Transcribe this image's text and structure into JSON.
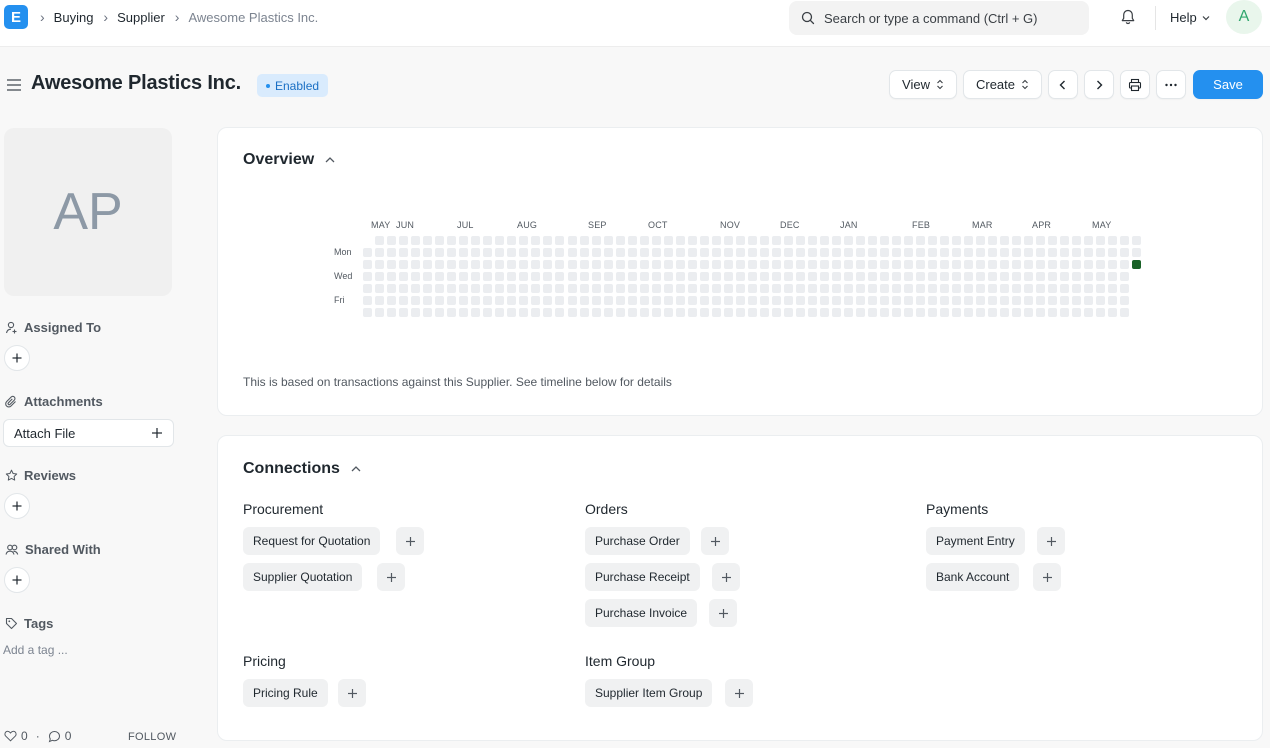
{
  "navbar": {
    "logo_letter": "E",
    "breadcrumbs": [
      "Buying",
      "Supplier",
      "Awesome Plastics Inc."
    ],
    "search_placeholder": "Search or type a command (Ctrl + G)",
    "help_label": "Help",
    "user_initial": "A"
  },
  "page": {
    "title": "Awesome Plastics Inc.",
    "status": "Enabled",
    "status_color": "#2490ef"
  },
  "toolbar": {
    "view_label": "View",
    "create_label": "Create",
    "save_label": "Save"
  },
  "sidebar": {
    "avatar_initials": "AP",
    "assigned_to_label": "Assigned To",
    "attachments_label": "Attachments",
    "attach_file_label": "Attach File",
    "reviews_label": "Reviews",
    "shared_with_label": "Shared With",
    "tags_label": "Tags",
    "add_tag_label": "Add a tag ...",
    "likes_count": "0",
    "comments_count": "0",
    "follow_label": "FOLLOW"
  },
  "overview": {
    "title": "Overview",
    "months": [
      "MAY",
      "JUN",
      "JUL",
      "AUG",
      "SEP",
      "OCT",
      "NOV",
      "DEC",
      "JAN",
      "FEB",
      "MAR",
      "APR",
      "MAY"
    ],
    "days": [
      "Mon",
      "Wed",
      "Fri"
    ],
    "active_color": "#196127",
    "empty_color": "#ebedf0",
    "note": "This is based on transactions against this Supplier. See timeline below for details"
  },
  "connections": {
    "title": "Connections",
    "groups": [
      {
        "title": "Procurement",
        "items": [
          "Request for Quotation",
          "Supplier Quotation"
        ]
      },
      {
        "title": "Orders",
        "items": [
          "Purchase Order",
          "Purchase Receipt",
          "Purchase Invoice"
        ]
      },
      {
        "title": "Payments",
        "items": [
          "Payment Entry",
          "Bank Account"
        ]
      },
      {
        "title": "Pricing",
        "items": [
          "Pricing Rule"
        ]
      },
      {
        "title": "Item Group",
        "items": [
          "Supplier Item Group"
        ]
      }
    ]
  }
}
